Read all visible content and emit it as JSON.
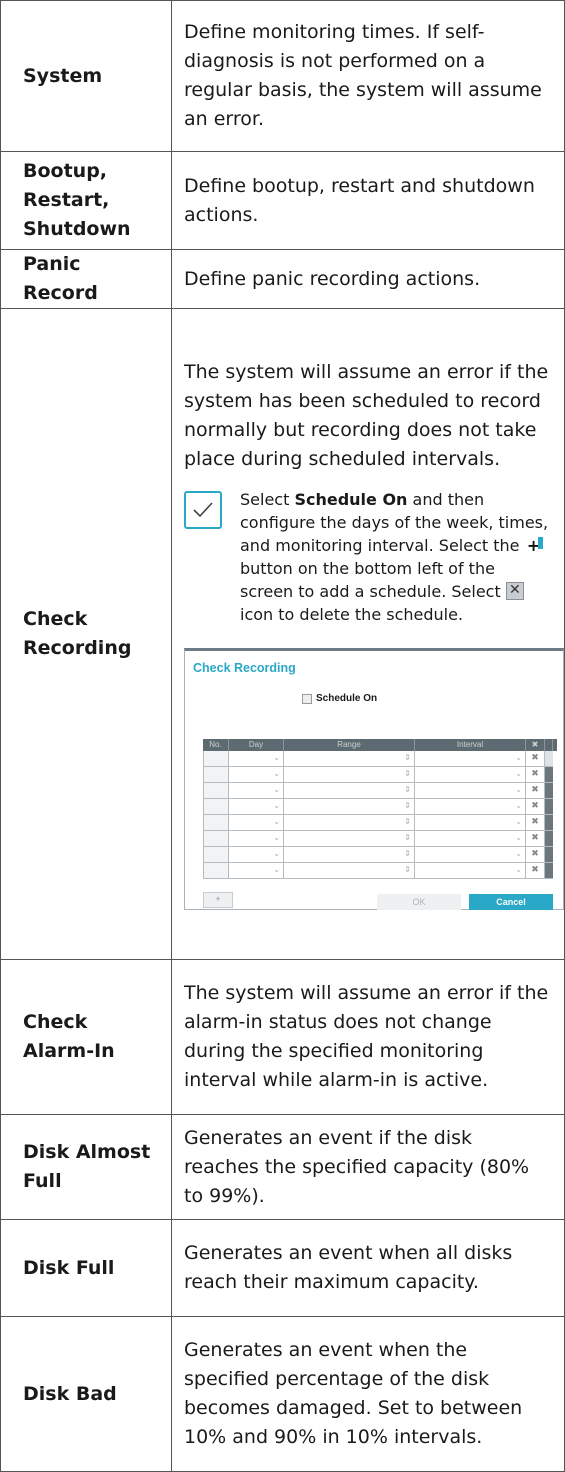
{
  "rows": [
    {
      "term": "System",
      "desc": "Define monitoring times. If self-diagnosis is not performed on a regular basis, the system will assume an error."
    },
    {
      "term": "Bootup, Restart, Shutdown",
      "desc": "Define bootup, restart and shutdown actions."
    },
    {
      "term": "Panic Record",
      "desc": "Define panic recording actions."
    },
    {
      "term": "Check Recording",
      "desc": "The system will assume an error if the system has been scheduled to record normally but recording does not take place during scheduled intervals."
    },
    {
      "term": "Check Alarm-In",
      "desc": "The system will assume an error if the alarm-in status does not change during the specified monitoring interval while alarm-in is active."
    },
    {
      "term": "Disk Almost Full",
      "desc": "Generates an event if the disk reaches the specified capacity (80% to 99%)."
    },
    {
      "term": "Disk Full",
      "desc": "Generates an event when all disks reach their maximum capacity."
    },
    {
      "term": "Disk Bad",
      "desc": "Generates an event when the specified percentage of the disk becomes damaged. Set to between 10% and 90% in 10% intervals."
    }
  ],
  "note": {
    "part1": "Select ",
    "bold": "Schedule On",
    "part2": " and then configure the days of the week, times, and monitoring interval. Select the ",
    "part3": " button on the bottom left of the screen to add a schedule. Select ",
    "part4": " icon to delete the schedule.",
    "add_icon": "plus-icon",
    "delete_icon": "x-box-icon"
  },
  "dialog": {
    "title": "Check Recording",
    "checkbox_label": "Schedule On",
    "columns": [
      "No.",
      "Day",
      "Range",
      "Interval",
      "✖"
    ],
    "row_count": 8,
    "add_label": "+",
    "ok_label": "OK",
    "cancel_label": "Cancel"
  }
}
